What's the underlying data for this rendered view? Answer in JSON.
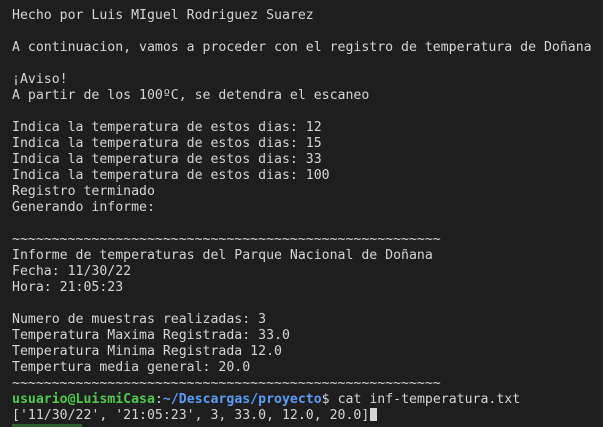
{
  "terminal": {
    "lines": {
      "author": "Hecho por Luis MIguel Rodriguez Suarez",
      "intro": "A continuacion, vamos a proceder con el registro de temperatura de Doñana",
      "aviso": "¡Aviso!",
      "aviso_detail": "A partir de los 100ºC, se detendra el escaneo",
      "temp1": "Indica la temperatura de estos dias: 12",
      "temp2": "Indica la temperatura de estos dias: 15",
      "temp3": "Indica la temperatura de estos dias: 33",
      "temp4": "Indica la temperatura de estos dias: 100",
      "registro": "Registro terminado",
      "generando": "Generando informe:",
      "separator_top": "~~~~~~~~~~~~~~~~~~~~~~~~~~~~~~~~~~~~~~~~~~~~~~~~~~~~~~",
      "report_title": "Informe de temperaturas del Parque Nacional de Doñana",
      "fecha": "Fecha: 11/30/22",
      "hora": "Hora: 21:05:23",
      "muestras": "Numero de muestras realizadas: 3",
      "max": "Temperatura Maxima Registrada: 33.0",
      "min": "Temperatura Minima Registrada 12.0",
      "media": "Tempertura media general: 20.0",
      "separator_bottom": "~~~~~~~~~~~~~~~~~~~~~~~~~~~~~~~~~~~~~~~~~~~~~~~~~~~~~~",
      "file_output": "['11/30/22', '21:05:23', 3, 33.0, 12.0, 20.0]"
    },
    "prompt": {
      "user_host": "usuario@LuismiCasa",
      "colon": ":",
      "path": "~/Descargas/proyecto",
      "dollar": "$",
      "command": " cat inf-temperatura.txt"
    },
    "colors": {
      "background": "#1e1e1e",
      "text": "#d4d4d4",
      "prompt_user": "#4ec94e",
      "prompt_path": "#5b9bf5"
    }
  }
}
